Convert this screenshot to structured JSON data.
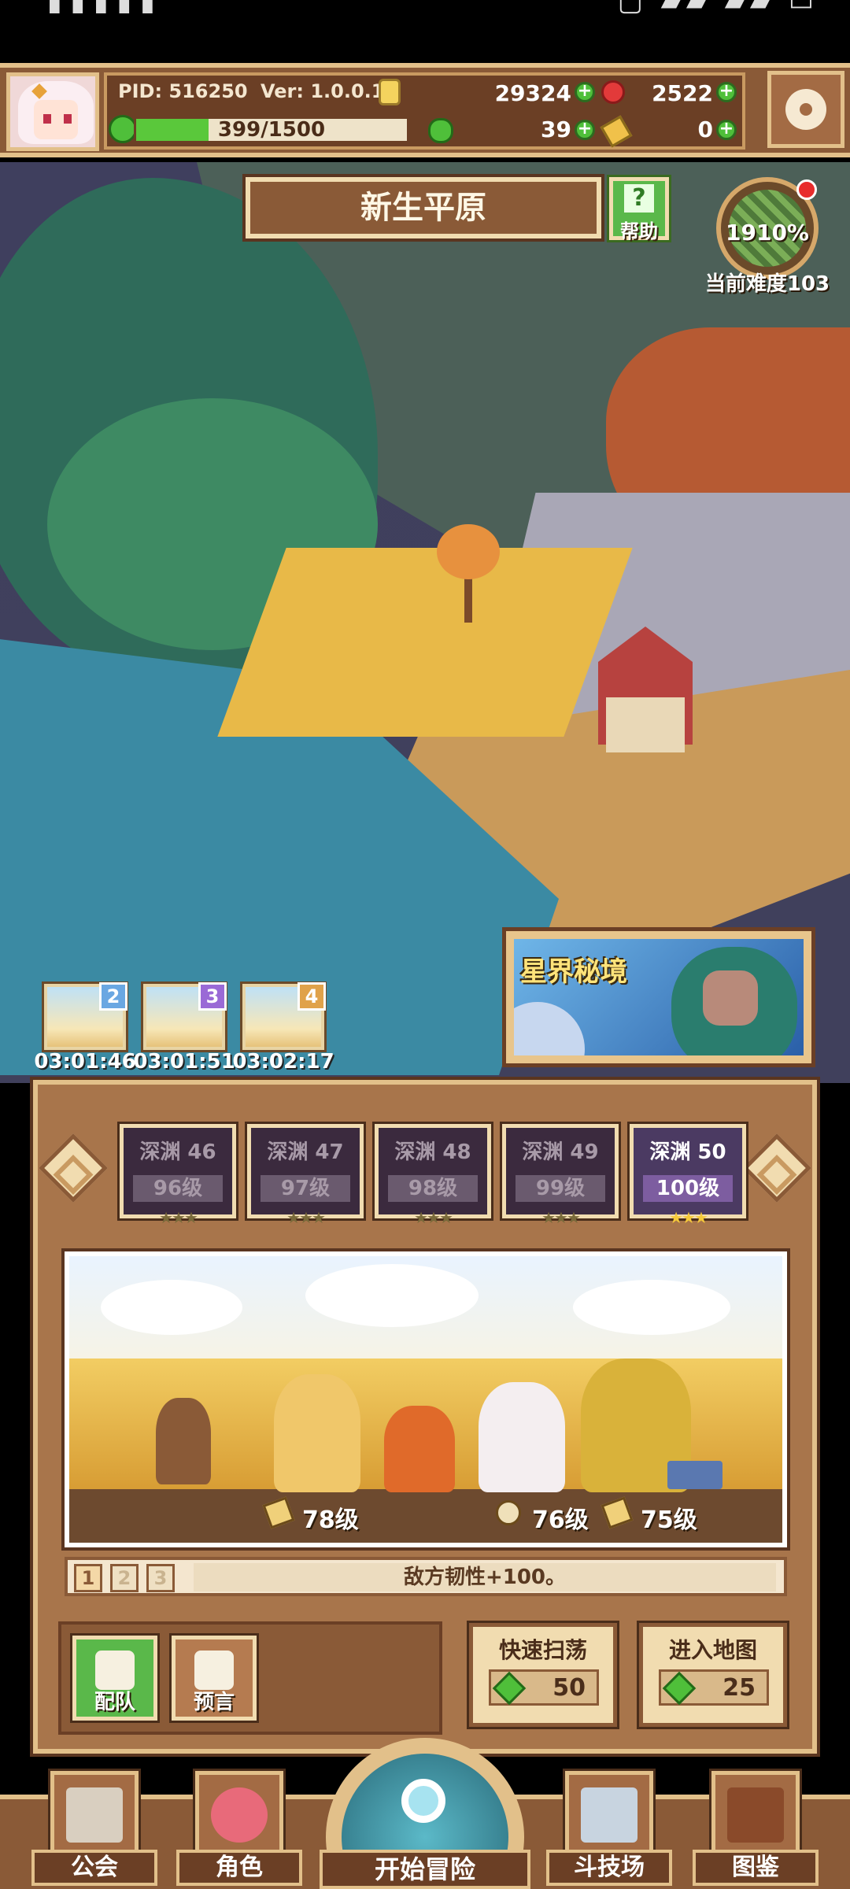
{
  "hud": {
    "pid": "PID: 516250",
    "version": "Ver: 1.0.0.10",
    "gold": "29324",
    "ruby": "2522",
    "stamina": "399/1500",
    "stamina_fraction": 0.266,
    "clover": "39",
    "ticket": "0"
  },
  "map": {
    "title": "新生平原",
    "help_label": "帮助",
    "difficulty_pct": "1910%",
    "difficulty_label": "当前难度103",
    "star_realm": "星界秘境"
  },
  "chests": [
    {
      "level": "2",
      "timer": "03:01:46"
    },
    {
      "level": "3",
      "timer": "03:01:51"
    },
    {
      "level": "4",
      "timer": "03:02:17"
    }
  ],
  "stages": [
    {
      "name": "深渊 46",
      "level": "96级",
      "stars": "★★★"
    },
    {
      "name": "深渊 47",
      "level": "97级",
      "stars": "★★★"
    },
    {
      "name": "深渊 48",
      "level": "98级",
      "stars": "★★★"
    },
    {
      "name": "深渊 49",
      "level": "99级",
      "stars": "★★★"
    },
    {
      "name": "深渊 50",
      "level": "100级",
      "stars": "★★★"
    }
  ],
  "enemies": {
    "levels": [
      "78级",
      "76级",
      "75级"
    ]
  },
  "buff": {
    "tabs": [
      "1",
      "2",
      "3"
    ],
    "text": "敌方韧性+100。"
  },
  "actions": {
    "team": "配队",
    "prophecy": "预言",
    "sweep_label": "快速扫荡",
    "sweep_cost": "50",
    "enter_label": "进入地图",
    "enter_cost": "25"
  },
  "nav": {
    "guild": "公会",
    "character": "角色",
    "adventure": "开始冒险",
    "arena": "斗技场",
    "codex": "图鉴"
  },
  "colors": {
    "panel_brown": "#a8754b",
    "frame_cream": "#e2c08a",
    "accent_green": "#5ab84a",
    "stage_active": "#7d5da0"
  }
}
